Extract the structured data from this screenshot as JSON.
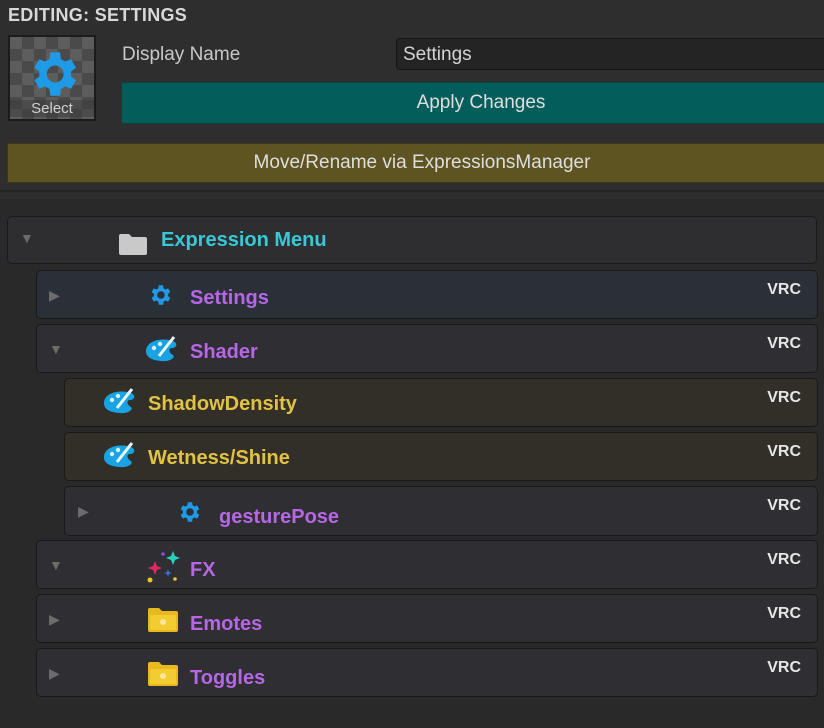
{
  "header": {
    "title": "EDITING: SETTINGS"
  },
  "icon_preview": {
    "icon": "gear-icon",
    "select_label": "Select"
  },
  "display_name": {
    "label": "Display Name",
    "value": "Settings"
  },
  "buttons": {
    "apply": "Apply Changes",
    "move_rename": "Move/Rename via ExpressionsManager"
  },
  "colors": {
    "apply_bg": "#035e5b",
    "move_bg": "#5e5421",
    "menu_label": "#38c8d6",
    "item_label": "#b567e5",
    "param_label": "#e2c243"
  },
  "tree": {
    "root": {
      "label": "Expression Menu",
      "icon": "folder-icon",
      "expanded": true
    },
    "items": [
      {
        "label": "Settings",
        "icon": "gear-icon",
        "tag": "VRC",
        "expanded": false
      },
      {
        "label": "Shader",
        "icon": "paint-palette-icon",
        "tag": "VRC",
        "expanded": true
      },
      {
        "label": "ShadowDensity",
        "icon": "paint-palette-icon",
        "tag": "VRC"
      },
      {
        "label": "Wetness/Shine",
        "icon": "paint-palette-icon",
        "tag": "VRC"
      },
      {
        "label": "gesturePose",
        "icon": "gear-icon",
        "tag": "VRC",
        "expanded": false
      },
      {
        "label": "FX",
        "icon": "sparkles-icon",
        "tag": "VRC",
        "expanded": true
      },
      {
        "label": "Emotes",
        "icon": "yellow-folder-icon",
        "tag": "VRC",
        "expanded": false
      },
      {
        "label": "Toggles",
        "icon": "yellow-folder-icon",
        "tag": "VRC",
        "expanded": false
      }
    ]
  }
}
